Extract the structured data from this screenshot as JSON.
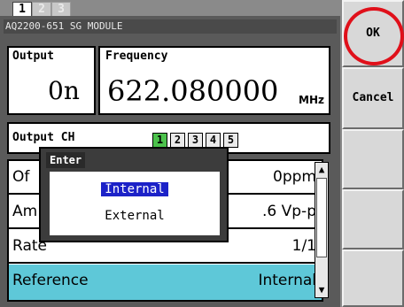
{
  "tabs": [
    "1",
    "2",
    "3"
  ],
  "module_title": "AQ2200-651 SG MODULE",
  "output": {
    "label": "Output",
    "value": "0n"
  },
  "frequency": {
    "label": "Frequency",
    "value": "622.080000",
    "unit": "MHz"
  },
  "output_ch": {
    "label": "Output CH",
    "channels": [
      "1",
      "2",
      "3",
      "4",
      "5"
    ],
    "active": "1"
  },
  "rows": [
    {
      "name": "Of",
      "value": "0ppm"
    },
    {
      "name": "Am",
      "value": ".6 Vp-p"
    },
    {
      "name": "Rate",
      "value": "1/1"
    },
    {
      "name": "Reference",
      "value": "Internal"
    }
  ],
  "popup": {
    "title": "Enter",
    "options": [
      "Internal",
      "External"
    ],
    "selected": "Internal"
  },
  "buttons": {
    "ok": "OK",
    "cancel": "Cancel"
  },
  "colors": {
    "ok_highlight_ring": "#e0101a",
    "selected_row": "#5ec8d8",
    "selected_option": "#1c22c8",
    "active_channel": "#4cc24c"
  }
}
